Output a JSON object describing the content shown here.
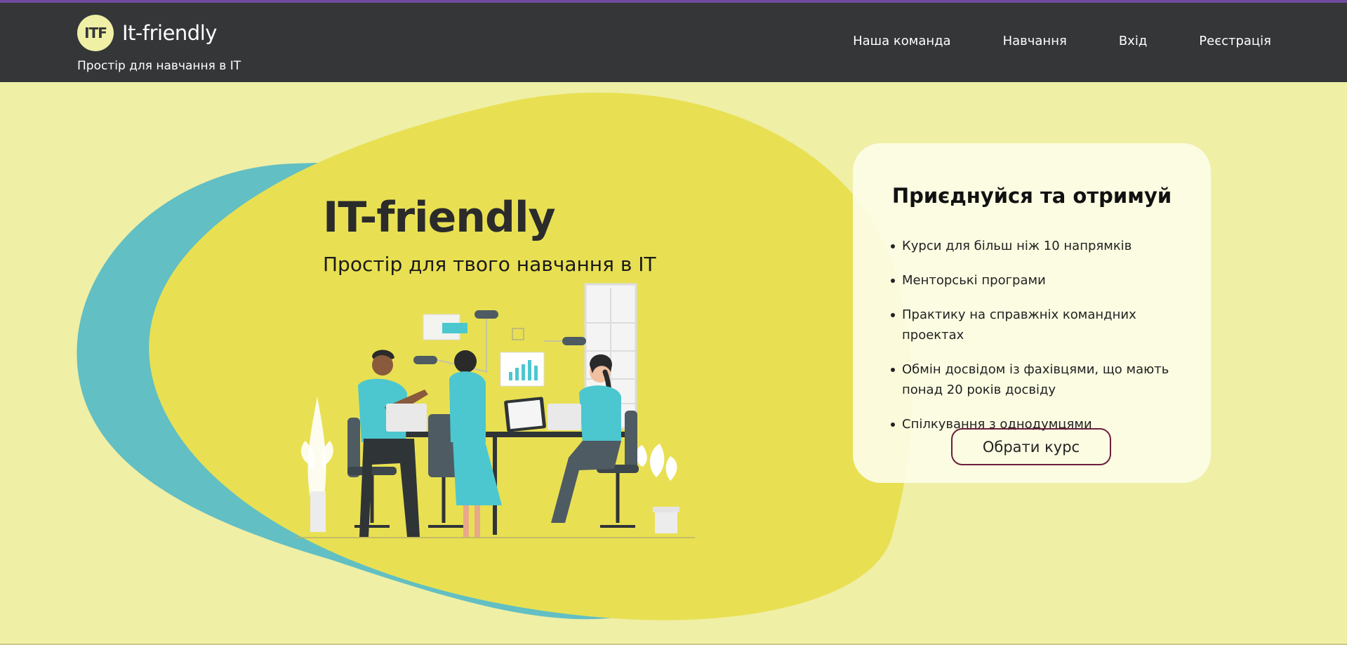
{
  "header": {
    "logo_text": "ITF",
    "brand_name": "It-friendly",
    "tagline": "Простір для навчання в ІТ",
    "nav": [
      {
        "label": "Наша команда"
      },
      {
        "label": "Навчання"
      },
      {
        "label": "Вхід"
      },
      {
        "label": "Реєстрація"
      }
    ]
  },
  "hero": {
    "title": "IT-friendly",
    "subtitle": "Простір для твого навчання в ІТ"
  },
  "card": {
    "title": "Приєднуйся та отримуй",
    "benefits": [
      "Курси для більш ніж 10 напрямків",
      "Менторські програми",
      "Практику на справжніх командних проектах",
      "Обмін досвідом із фахівцями, що мають понад 20 років досвіду",
      "Спілкування з однодумцями"
    ],
    "button_label": "Обрати курс"
  },
  "colors": {
    "header_bg": "#353638",
    "accent_line": "#6f4a9c",
    "page_bg": "#efefa6",
    "blob_yellow": "#e8e052",
    "blob_teal": "#62bfc3",
    "button_border": "#6b1f3c"
  }
}
